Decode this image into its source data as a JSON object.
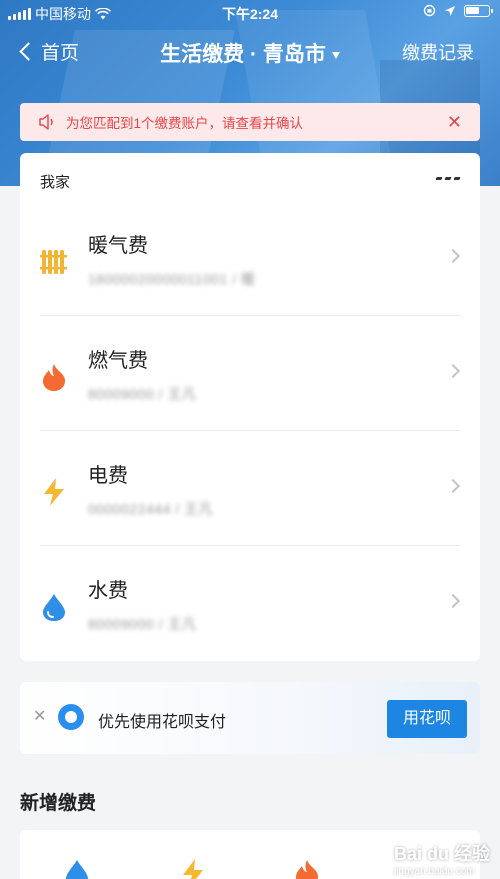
{
  "status_bar": {
    "carrier": "中国移动",
    "time": "下午2:24",
    "battery_level": 0.6
  },
  "nav": {
    "back_label": "首页",
    "title": "生活缴费 · 青岛市",
    "records_label": "缴费记录"
  },
  "notice": {
    "message": "为您匹配到1个缴费账户，请查看并确认"
  },
  "group": {
    "name": "我家"
  },
  "bills": [
    {
      "name": "暖气费",
      "account": "18000020000011001 / 暖",
      "icon": "radiator-icon",
      "color": "#f2b433"
    },
    {
      "name": "燃气费",
      "account": "80009000 / 王凡",
      "icon": "flame-icon",
      "color": "#f36b32"
    },
    {
      "name": "电费",
      "account": "0000022444 / 王凡",
      "icon": "lightning-icon",
      "color": "#f5b82e"
    },
    {
      "name": "水费",
      "account": "80009000 / 王凡",
      "icon": "water-drop-icon",
      "color": "#2f8fe6"
    }
  ],
  "huabei": {
    "label": "优先使用花呗支付",
    "button": "用花呗"
  },
  "new_section": {
    "title": "新增缴费"
  },
  "watermark": {
    "text": "Bai du 经验",
    "sub": "jingyan.baidu.com"
  }
}
